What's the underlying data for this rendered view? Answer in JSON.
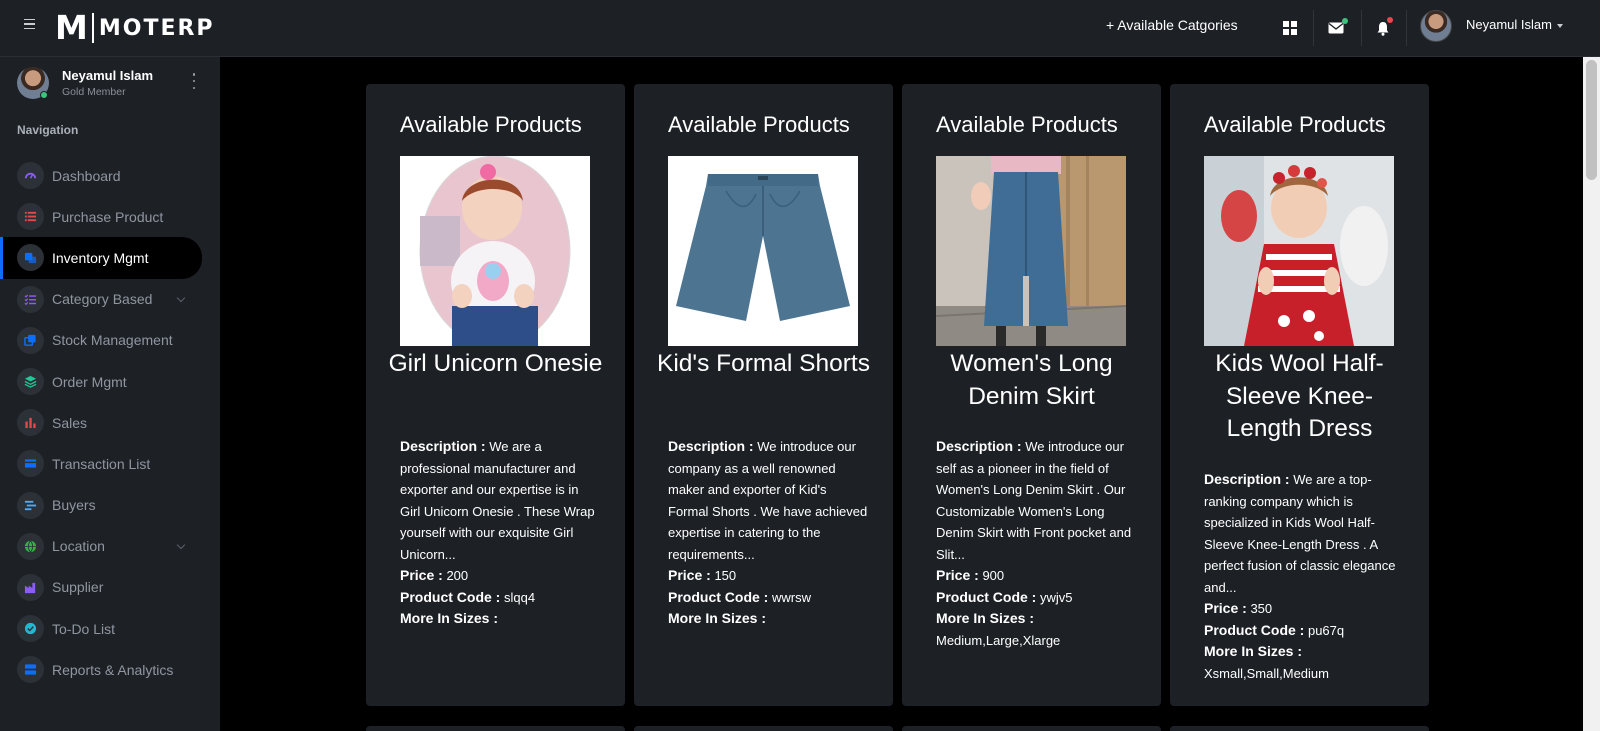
{
  "header": {
    "logo_letter": "M",
    "logo_text": "MOTERP",
    "available_categories": "+ Available Catgories",
    "user_name": "Neyamul Islam"
  },
  "sidebar": {
    "user_name": "Neyamul Islam",
    "user_role": "Gold Member",
    "nav_heading": "Navigation",
    "items": [
      {
        "label": "Dashboard",
        "icon": "gauge-icon",
        "color": "#8b5cf6"
      },
      {
        "label": "Purchase Product",
        "icon": "list-icon",
        "color": "#e5484d"
      },
      {
        "label": "Inventory Mgmt",
        "icon": "cube-icon",
        "color": "#0d6efd",
        "active": true
      },
      {
        "label": "Category Based",
        "icon": "checklist-icon",
        "color": "#8b5cf6",
        "has_submenu": true
      },
      {
        "label": "Stock Management",
        "icon": "copy-icon",
        "color": "#0d6efd"
      },
      {
        "label": "Order Mgmt",
        "icon": "layers-icon",
        "color": "#20c997"
      },
      {
        "label": "Sales",
        "icon": "bar-chart-icon",
        "color": "#e5484d"
      },
      {
        "label": "Transaction List",
        "icon": "card-icon",
        "color": "#0d6efd"
      },
      {
        "label": "Buyers",
        "icon": "filter-icon",
        "color": "#4dabf7"
      },
      {
        "label": "Location",
        "icon": "globe-icon",
        "color": "#2fb344",
        "has_submenu": true
      },
      {
        "label": "Supplier",
        "icon": "factory-icon",
        "color": "#8b5cf6"
      },
      {
        "label": "To-Do List",
        "icon": "check-circle-icon",
        "color": "#22b8cf"
      },
      {
        "label": "Reports & Analytics",
        "icon": "server-icon",
        "color": "#0d6efd"
      }
    ]
  },
  "products": [
    {
      "heading": "Available Products",
      "title": "Girl Unicorn Onesie",
      "description_label": "Description :",
      "description": "We are a professional manufacturer and exporter and our expertise is in Girl Unicorn Onesie . These Wrap yourself with our exquisite Girl Unicorn...",
      "price_label": "Price :",
      "price": "200",
      "code_label": "Product Code :",
      "code": "slqq4",
      "sizes_label": "More In Sizes :",
      "sizes": ""
    },
    {
      "heading": "Available Products",
      "title": "Kid's Formal Shorts",
      "description_label": "Description :",
      "description": "We introduce our company as a well renowned maker and exporter of Kid's Formal Shorts . We have achieved expertise in catering to the requirements...",
      "price_label": "Price :",
      "price": "150",
      "code_label": "Product Code :",
      "code": "wwrsw",
      "sizes_label": "More In Sizes :",
      "sizes": ""
    },
    {
      "heading": "Available Products",
      "title": "Women's Long Denim Skirt",
      "description_label": "Description :",
      "description": "We introduce our self as a pioneer in the field of Women's Long Denim Skirt . Our Customizable Women's Long Denim Skirt with Front pocket and Slit...",
      "price_label": "Price :",
      "price": "900",
      "code_label": "Product Code :",
      "code": "ywjv5",
      "sizes_label": "More In Sizes :",
      "sizes": "Medium,Large,Xlarge"
    },
    {
      "heading": "Available Products",
      "title": "Kids Wool Half-Sleeve Knee-Length Dress",
      "description_label": "Description :",
      "description": "We are a top-ranking company which is specialized in Kids Wool Half-Sleeve Knee-Length Dress . A perfect fusion of classic elegance and...",
      "price_label": "Price :",
      "price": "350",
      "code_label": "Product Code :",
      "code": "pu67q",
      "sizes_label": "More In Sizes :",
      "sizes": "Xsmall,Small,Medium"
    }
  ],
  "colors": {
    "surface": "#1d2126",
    "background": "#000000",
    "accent": "#0d6efd",
    "online": "#3ac47d"
  }
}
